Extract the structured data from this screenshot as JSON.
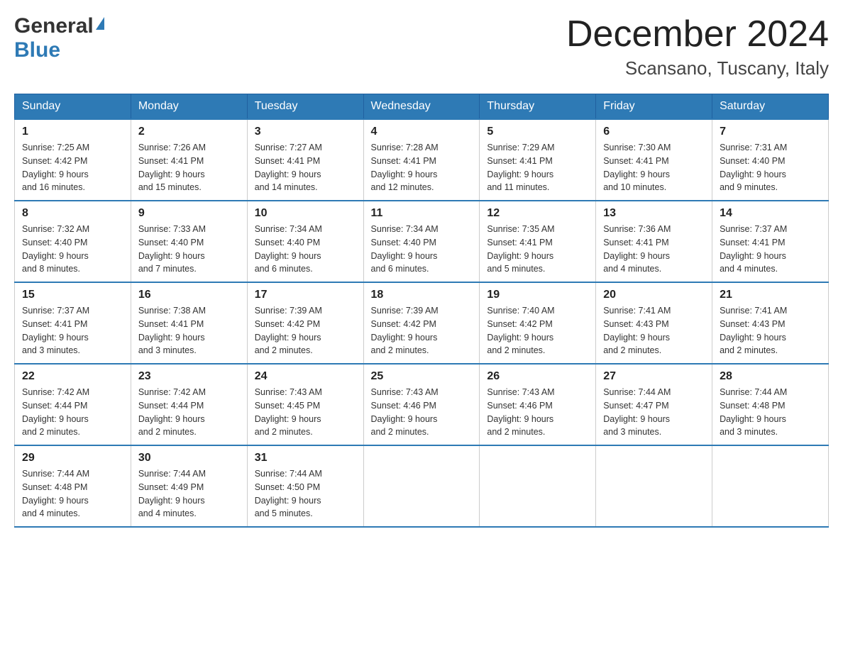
{
  "header": {
    "logo_general": "General",
    "logo_blue": "Blue",
    "month_year": "December 2024",
    "location": "Scansano, Tuscany, Italy"
  },
  "days_of_week": [
    "Sunday",
    "Monday",
    "Tuesday",
    "Wednesday",
    "Thursday",
    "Friday",
    "Saturday"
  ],
  "weeks": [
    [
      {
        "day": "1",
        "sunrise": "7:25 AM",
        "sunset": "4:42 PM",
        "daylight": "9 hours and 16 minutes."
      },
      {
        "day": "2",
        "sunrise": "7:26 AM",
        "sunset": "4:41 PM",
        "daylight": "9 hours and 15 minutes."
      },
      {
        "day": "3",
        "sunrise": "7:27 AM",
        "sunset": "4:41 PM",
        "daylight": "9 hours and 14 minutes."
      },
      {
        "day": "4",
        "sunrise": "7:28 AM",
        "sunset": "4:41 PM",
        "daylight": "9 hours and 12 minutes."
      },
      {
        "day": "5",
        "sunrise": "7:29 AM",
        "sunset": "4:41 PM",
        "daylight": "9 hours and 11 minutes."
      },
      {
        "day": "6",
        "sunrise": "7:30 AM",
        "sunset": "4:41 PM",
        "daylight": "9 hours and 10 minutes."
      },
      {
        "day": "7",
        "sunrise": "7:31 AM",
        "sunset": "4:40 PM",
        "daylight": "9 hours and 9 minutes."
      }
    ],
    [
      {
        "day": "8",
        "sunrise": "7:32 AM",
        "sunset": "4:40 PM",
        "daylight": "9 hours and 8 minutes."
      },
      {
        "day": "9",
        "sunrise": "7:33 AM",
        "sunset": "4:40 PM",
        "daylight": "9 hours and 7 minutes."
      },
      {
        "day": "10",
        "sunrise": "7:34 AM",
        "sunset": "4:40 PM",
        "daylight": "9 hours and 6 minutes."
      },
      {
        "day": "11",
        "sunrise": "7:34 AM",
        "sunset": "4:40 PM",
        "daylight": "9 hours and 6 minutes."
      },
      {
        "day": "12",
        "sunrise": "7:35 AM",
        "sunset": "4:41 PM",
        "daylight": "9 hours and 5 minutes."
      },
      {
        "day": "13",
        "sunrise": "7:36 AM",
        "sunset": "4:41 PM",
        "daylight": "9 hours and 4 minutes."
      },
      {
        "day": "14",
        "sunrise": "7:37 AM",
        "sunset": "4:41 PM",
        "daylight": "9 hours and 4 minutes."
      }
    ],
    [
      {
        "day": "15",
        "sunrise": "7:37 AM",
        "sunset": "4:41 PM",
        "daylight": "9 hours and 3 minutes."
      },
      {
        "day": "16",
        "sunrise": "7:38 AM",
        "sunset": "4:41 PM",
        "daylight": "9 hours and 3 minutes."
      },
      {
        "day": "17",
        "sunrise": "7:39 AM",
        "sunset": "4:42 PM",
        "daylight": "9 hours and 2 minutes."
      },
      {
        "day": "18",
        "sunrise": "7:39 AM",
        "sunset": "4:42 PM",
        "daylight": "9 hours and 2 minutes."
      },
      {
        "day": "19",
        "sunrise": "7:40 AM",
        "sunset": "4:42 PM",
        "daylight": "9 hours and 2 minutes."
      },
      {
        "day": "20",
        "sunrise": "7:41 AM",
        "sunset": "4:43 PM",
        "daylight": "9 hours and 2 minutes."
      },
      {
        "day": "21",
        "sunrise": "7:41 AM",
        "sunset": "4:43 PM",
        "daylight": "9 hours and 2 minutes."
      }
    ],
    [
      {
        "day": "22",
        "sunrise": "7:42 AM",
        "sunset": "4:44 PM",
        "daylight": "9 hours and 2 minutes."
      },
      {
        "day": "23",
        "sunrise": "7:42 AM",
        "sunset": "4:44 PM",
        "daylight": "9 hours and 2 minutes."
      },
      {
        "day": "24",
        "sunrise": "7:43 AM",
        "sunset": "4:45 PM",
        "daylight": "9 hours and 2 minutes."
      },
      {
        "day": "25",
        "sunrise": "7:43 AM",
        "sunset": "4:46 PM",
        "daylight": "9 hours and 2 minutes."
      },
      {
        "day": "26",
        "sunrise": "7:43 AM",
        "sunset": "4:46 PM",
        "daylight": "9 hours and 2 minutes."
      },
      {
        "day": "27",
        "sunrise": "7:44 AM",
        "sunset": "4:47 PM",
        "daylight": "9 hours and 3 minutes."
      },
      {
        "day": "28",
        "sunrise": "7:44 AM",
        "sunset": "4:48 PM",
        "daylight": "9 hours and 3 minutes."
      }
    ],
    [
      {
        "day": "29",
        "sunrise": "7:44 AM",
        "sunset": "4:48 PM",
        "daylight": "9 hours and 4 minutes."
      },
      {
        "day": "30",
        "sunrise": "7:44 AM",
        "sunset": "4:49 PM",
        "daylight": "9 hours and 4 minutes."
      },
      {
        "day": "31",
        "sunrise": "7:44 AM",
        "sunset": "4:50 PM",
        "daylight": "9 hours and 5 minutes."
      },
      null,
      null,
      null,
      null
    ]
  ],
  "labels": {
    "sunrise": "Sunrise: ",
    "sunset": "Sunset: ",
    "daylight": "Daylight: "
  }
}
